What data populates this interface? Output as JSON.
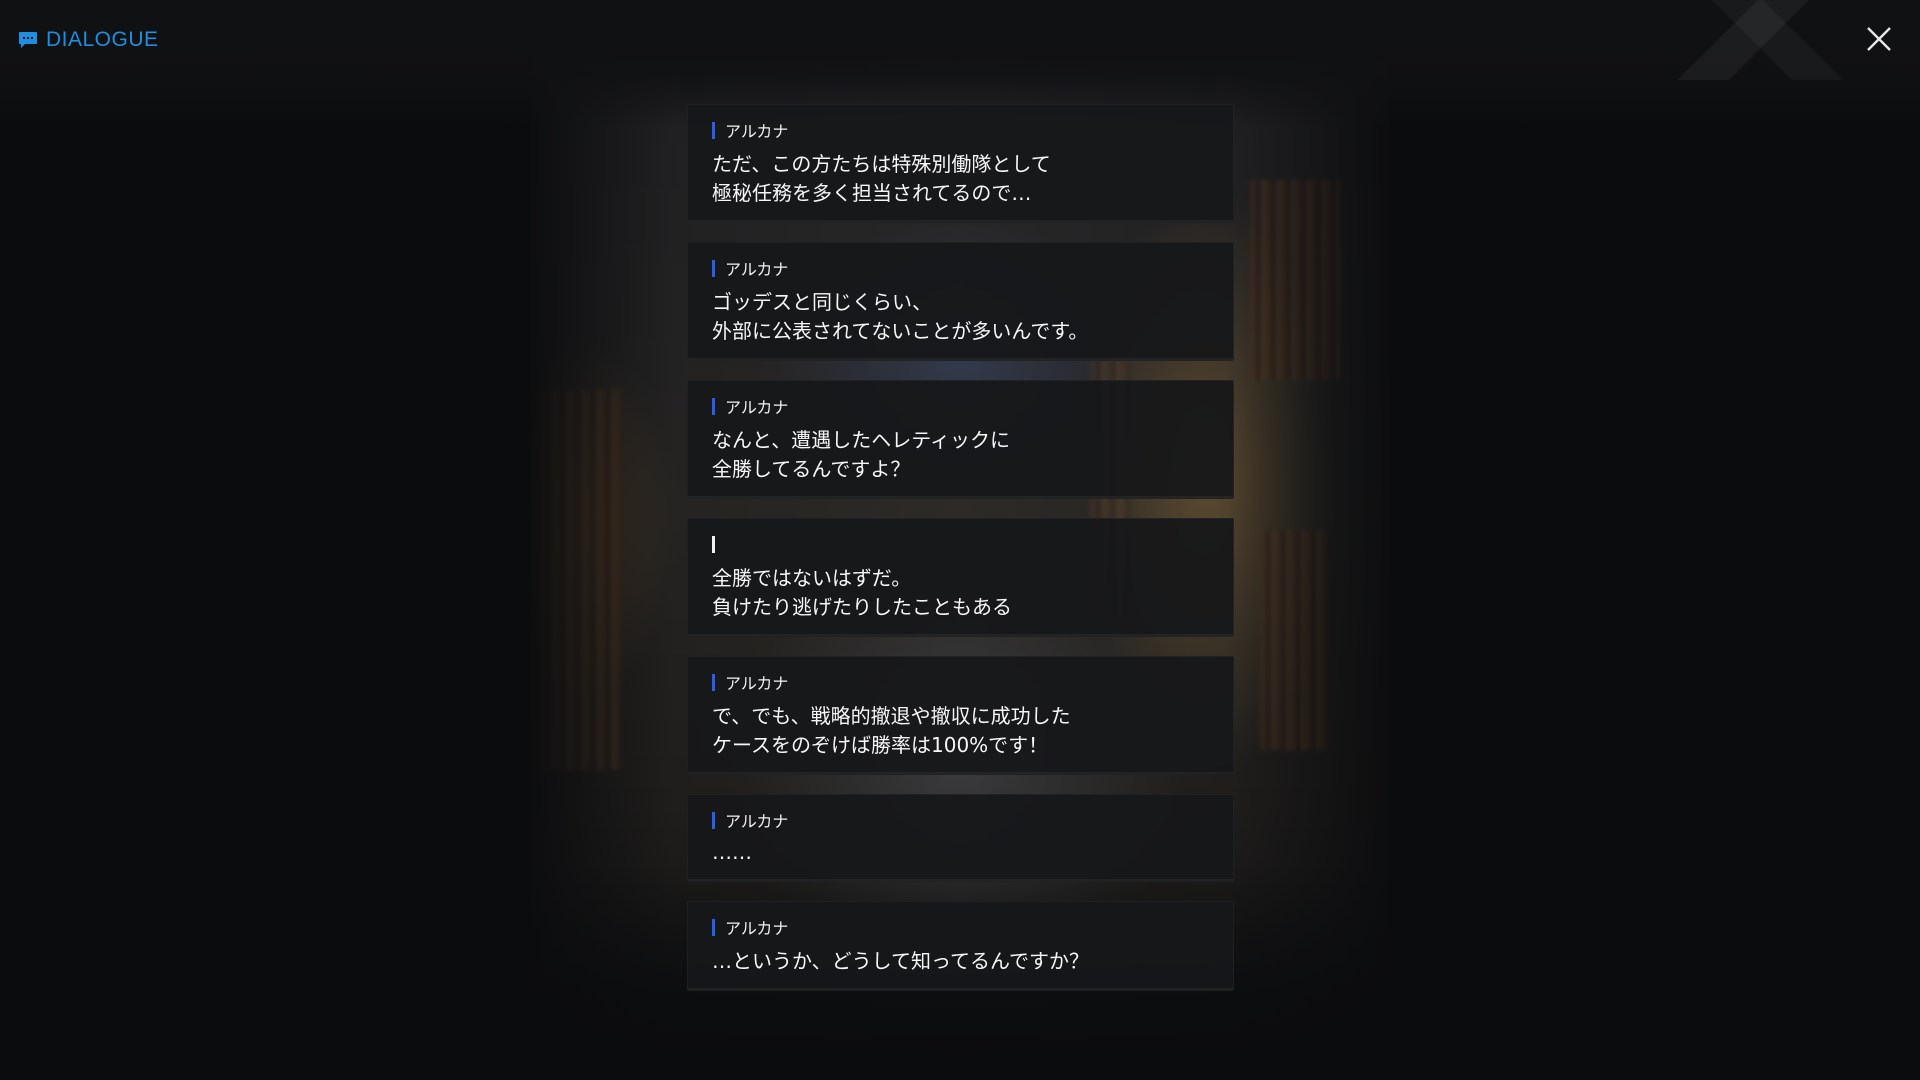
{
  "header": {
    "title": "DIALOGUE",
    "icon": "chat-bubble-icon",
    "accent_color": "#1e8fe0"
  },
  "close_button": {
    "icon": "close-icon"
  },
  "dialogue": [
    {
      "speaker": "アルカナ",
      "lines": [
        "ただ、この方たちは特殊別働隊として",
        "極秘任務を多く担当されてるので…"
      ]
    },
    {
      "speaker": "アルカナ",
      "lines": [
        "ゴッデスと同じくらい、",
        "外部に公表されてないことが多いんです。"
      ]
    },
    {
      "speaker": "アルカナ",
      "lines": [
        "なんと、遭遇したヘレティックに",
        "全勝してるんですよ？"
      ]
    },
    {
      "speaker": "",
      "lines": [
        "全勝ではないはずだ。",
        "負けたり逃げたりしたこともある"
      ]
    },
    {
      "speaker": "アルカナ",
      "lines": [
        "で、でも、戦略的撤退や撤収に成功した",
        "ケースをのぞけば勝率は100%です！"
      ]
    },
    {
      "speaker": "アルカナ",
      "lines": [
        "……"
      ]
    },
    {
      "speaker": "アルカナ",
      "lines": [
        "…というか、どうして知ってるんですか？"
      ]
    }
  ],
  "colors": {
    "speaker_bar": "#2b5fe0",
    "player_bar": "#f0f0f0",
    "card_bg": "#16171a"
  }
}
